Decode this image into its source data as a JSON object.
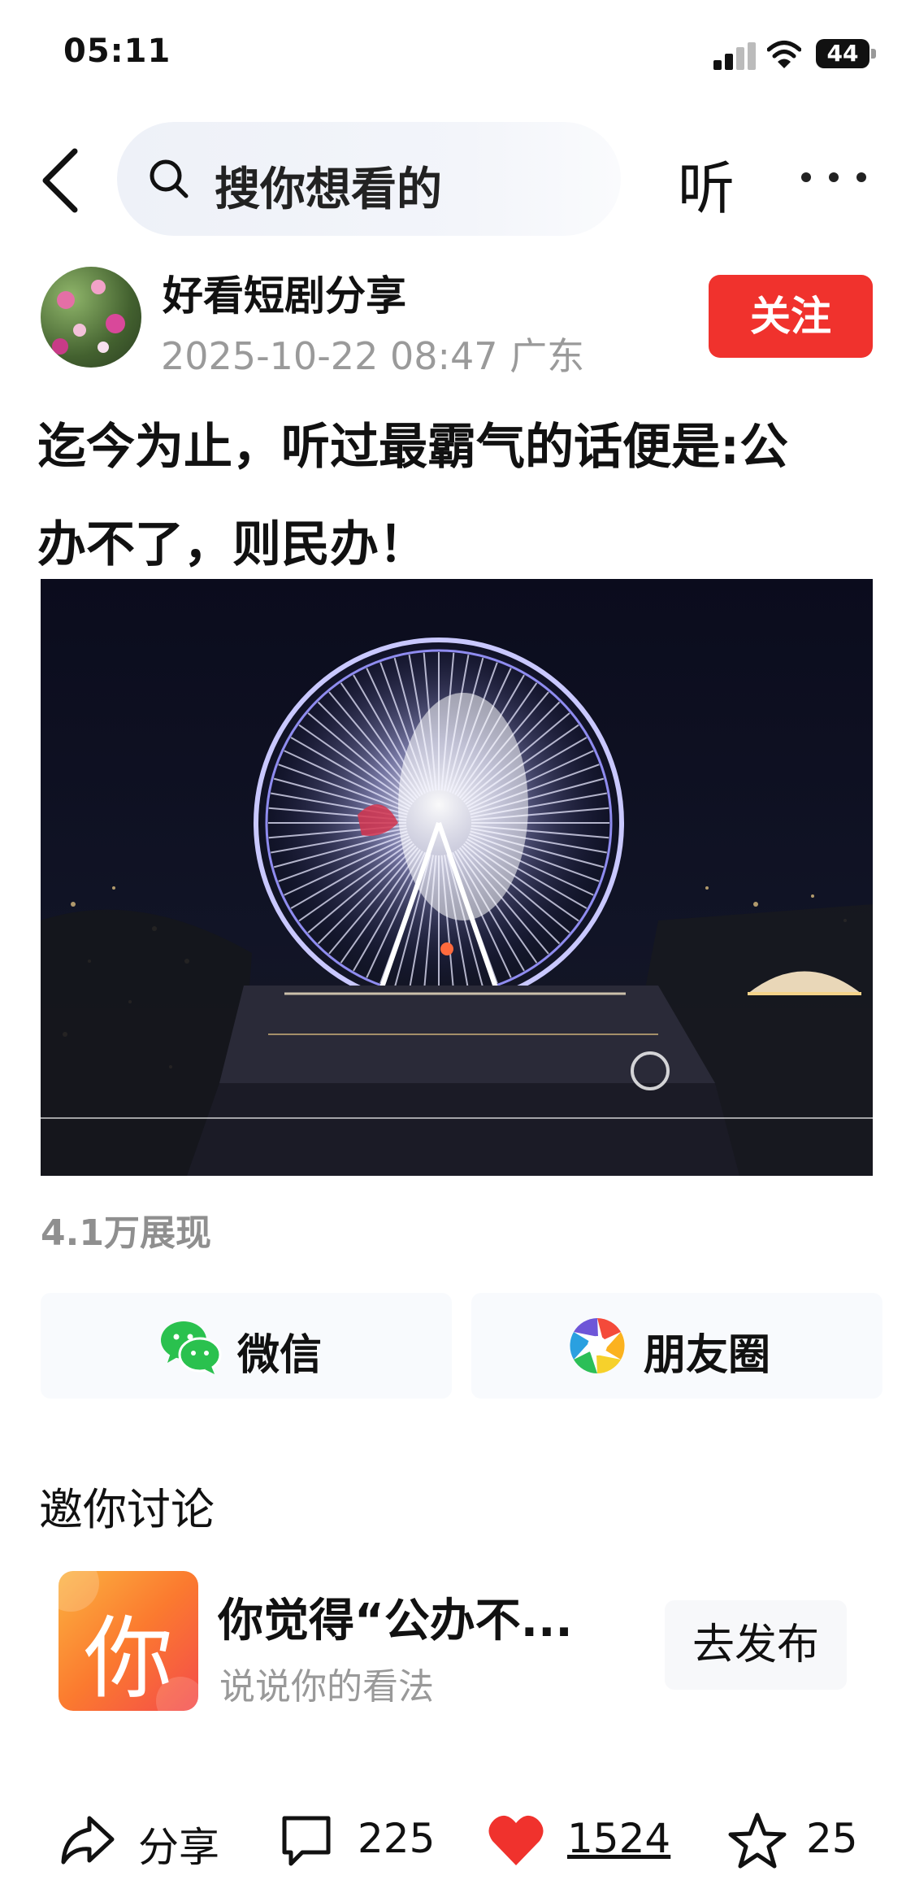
{
  "status_bar": {
    "time": "05:11",
    "battery": "44"
  },
  "nav": {
    "search_placeholder": "搜你想看的",
    "listen_label": "听"
  },
  "author": {
    "name": "好看短剧分享",
    "meta": "2025-10-22 08:47  广东",
    "follow_label": "关注"
  },
  "post": {
    "title_line1": "迄今为止，听过最霸气的话便是:公",
    "title_line2": "办不了，则民办！",
    "views": "4.1万展现"
  },
  "share": {
    "wechat_label": "微信",
    "moments_label": "朋友圈"
  },
  "discuss": {
    "heading": "邀你讨论",
    "avatar_char": "你",
    "topic_title": "你觉得“公办不...",
    "topic_sub": "说说你的看法",
    "publish_label": "去发布"
  },
  "bottom_bar": {
    "share_label": "分享",
    "comments": "225",
    "likes": "1524",
    "favorites": "25"
  },
  "colors": {
    "accent_red": "#f0322d",
    "wechat_green": "#2ac14e",
    "like_red": "#f0322d"
  }
}
